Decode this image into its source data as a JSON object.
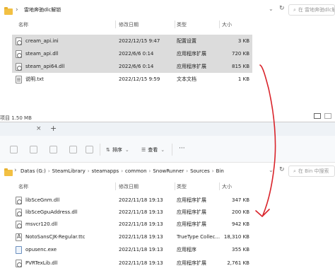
{
  "top_window": {
    "address": {
      "path": [
        "雷地奔驰dlc解锁"
      ]
    },
    "search_placeholder": "在 雷地奔驰dlc解锁",
    "columns": {
      "name": "名称",
      "modified": "修改日期",
      "type": "类型",
      "size": "大小"
    },
    "files": [
      {
        "name": "cream_api.ini",
        "modified": "2022/12/15 9:47",
        "type": "配置设置",
        "size": "3 KB",
        "icon": "settings-file-icon",
        "selected": true
      },
      {
        "name": "steam_api.dll",
        "modified": "2022/6/6 0:14",
        "type": "应用程序扩展",
        "size": "720 KB",
        "icon": "dll-file-icon",
        "selected": true
      },
      {
        "name": "steam_api64.dll",
        "modified": "2022/6/6 0:14",
        "type": "应用程序扩展",
        "size": "815 KB",
        "icon": "dll-file-icon",
        "selected": true
      },
      {
        "name": "说明.txt",
        "modified": "2022/12/15 9:59",
        "type": "文本文档",
        "size": "1 KB",
        "icon": "text-file-icon",
        "selected": false
      }
    ],
    "status": "项目 1.50 MB"
  },
  "bottom_window": {
    "tab_add": "+",
    "toolbar": {
      "sort": "排序",
      "view": "查看",
      "more": "···"
    },
    "address": {
      "path": [
        "Datas (G:)",
        "SteamLibrary",
        "steamapps",
        "common",
        "SnowRunner",
        "Sources",
        "Bin"
      ]
    },
    "search_placeholder": "在 Bin 中搜索",
    "columns": {
      "name": "名称",
      "modified": "修改日期",
      "type": "类型",
      "size": "大小"
    },
    "files": [
      {
        "name": "libSceGnm.dll",
        "modified": "2022/11/18 19:13",
        "type": "应用程序扩展",
        "size": "347 KB",
        "icon": "dll-file-icon"
      },
      {
        "name": "libSceGpuAddress.dll",
        "modified": "2022/11/18 19:13",
        "type": "应用程序扩展",
        "size": "200 KB",
        "icon": "dll-file-icon"
      },
      {
        "name": "msvcr120.dll",
        "modified": "2022/11/18 19:13",
        "type": "应用程序扩展",
        "size": "942 KB",
        "icon": "dll-file-icon"
      },
      {
        "name": "NotoSansCJK-Regular.ttc",
        "modified": "2022/11/18 19:13",
        "type": "TrueType Collec...",
        "size": "18,310 KB",
        "icon": "font-file-icon"
      },
      {
        "name": "opusenc.exe",
        "modified": "2022/11/18 19:13",
        "type": "应用程序",
        "size": "355 KB",
        "icon": "exe-file-icon"
      },
      {
        "name": "PVRTexLib.dll",
        "modified": "2022/11/18 19:13",
        "type": "应用程序扩展",
        "size": "2,761 KB",
        "icon": "dll-file-icon"
      }
    ]
  },
  "annotation": {
    "color": "#d9232a",
    "meaning": "drag-arrow-icon"
  }
}
